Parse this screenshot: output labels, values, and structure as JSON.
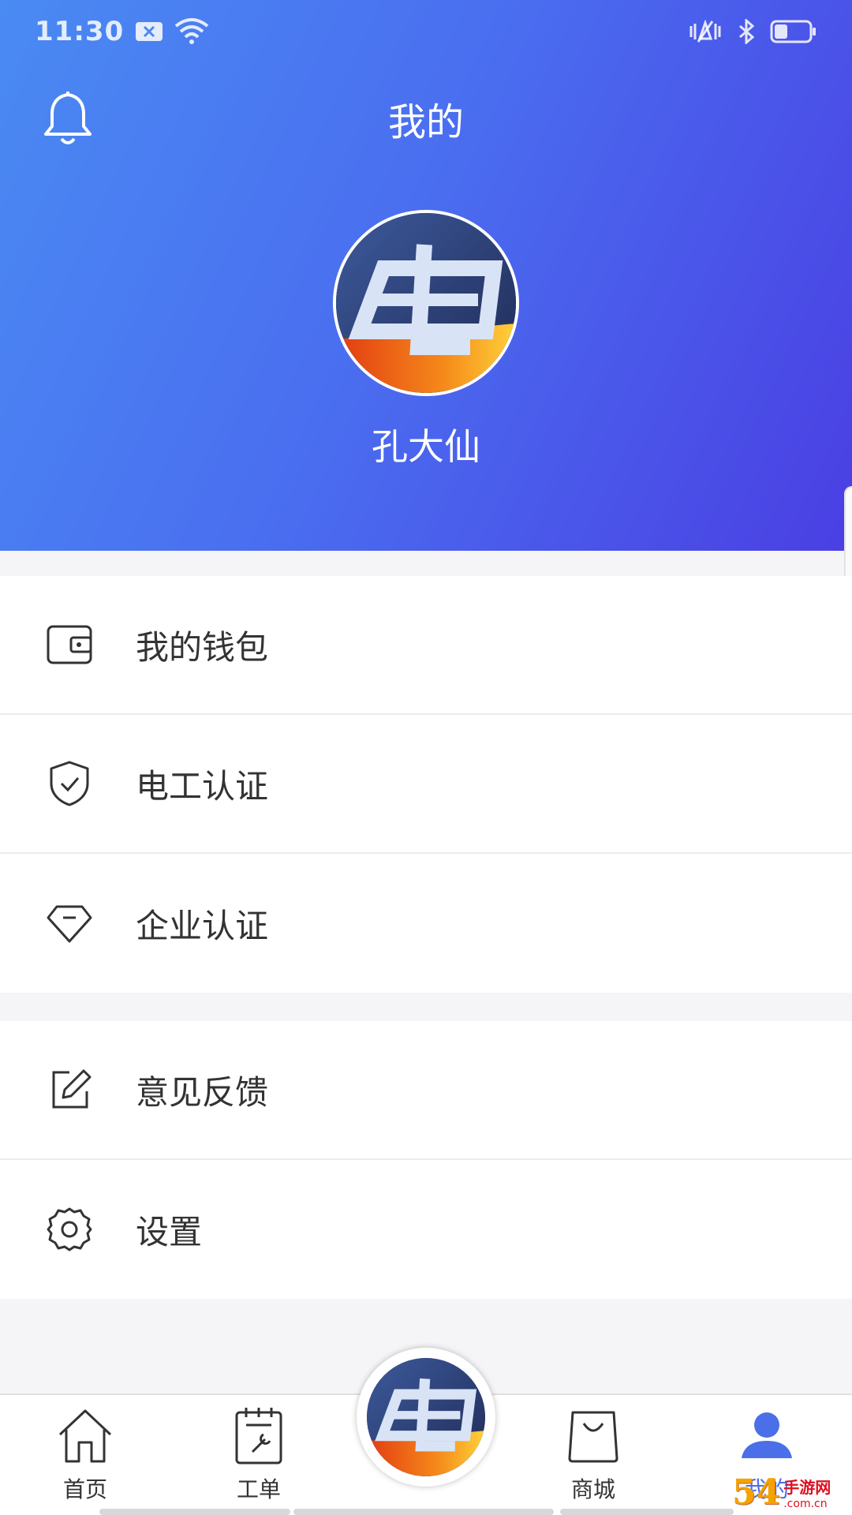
{
  "status_bar": {
    "time": "11:30"
  },
  "header": {
    "title": "我的",
    "username": "孔大仙"
  },
  "menu": {
    "group1": [
      {
        "label": "我的钱包",
        "icon": "wallet-icon"
      },
      {
        "label": "电工认证",
        "icon": "shield-check-icon"
      },
      {
        "label": "企业认证",
        "icon": "diamond-icon"
      }
    ],
    "group2": [
      {
        "label": "意见反馈",
        "icon": "edit-icon"
      },
      {
        "label": "设置",
        "icon": "gear-icon"
      }
    ]
  },
  "tabbar": {
    "home": "首页",
    "work_order": "工单",
    "mall": "商城",
    "mine": "我的"
  },
  "watermark": {
    "num": "54",
    "cn": "手游网",
    "url": ".com.cn"
  },
  "colors": {
    "header_start": "#4a8af3",
    "header_end": "#4a3fe3",
    "accent": "#4a6fe8"
  }
}
